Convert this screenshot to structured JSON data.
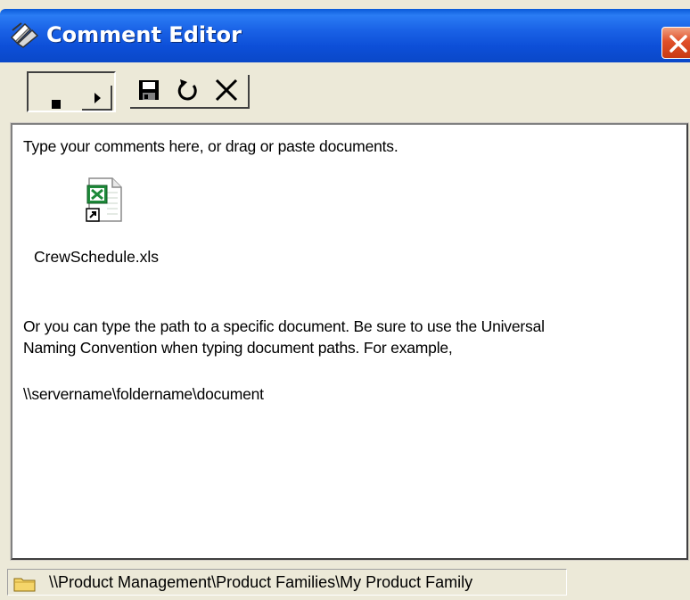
{
  "window": {
    "title": "Comment Editor",
    "title_icon": "comment-editor-icon",
    "close_icon": "close-icon"
  },
  "toolbar": {
    "arrow_icon": "right-arrow-icon",
    "save_icon": "save-icon",
    "refresh_icon": "refresh-icon",
    "delete_icon": "delete-icon"
  },
  "editor": {
    "line1": "Type your comments here, or drag or paste documents.",
    "attachment": {
      "name": "CrewSchedule.xls",
      "icon": "excel-document-shortcut-icon"
    },
    "line2": "Or you can type the path to a specific document. Be sure to use the Universal",
    "line3": "Naming Convention when typing document paths. For example,",
    "line4": "\\\\servername\\foldername\\document"
  },
  "statusbar": {
    "path": "\\\\Product Management\\Product Families\\My Product Family",
    "folder_icon": "folder-icon"
  },
  "colors": {
    "titlebar": "#1a62e6",
    "window_bg": "#ece9d8",
    "close_button": "#e0502a"
  }
}
